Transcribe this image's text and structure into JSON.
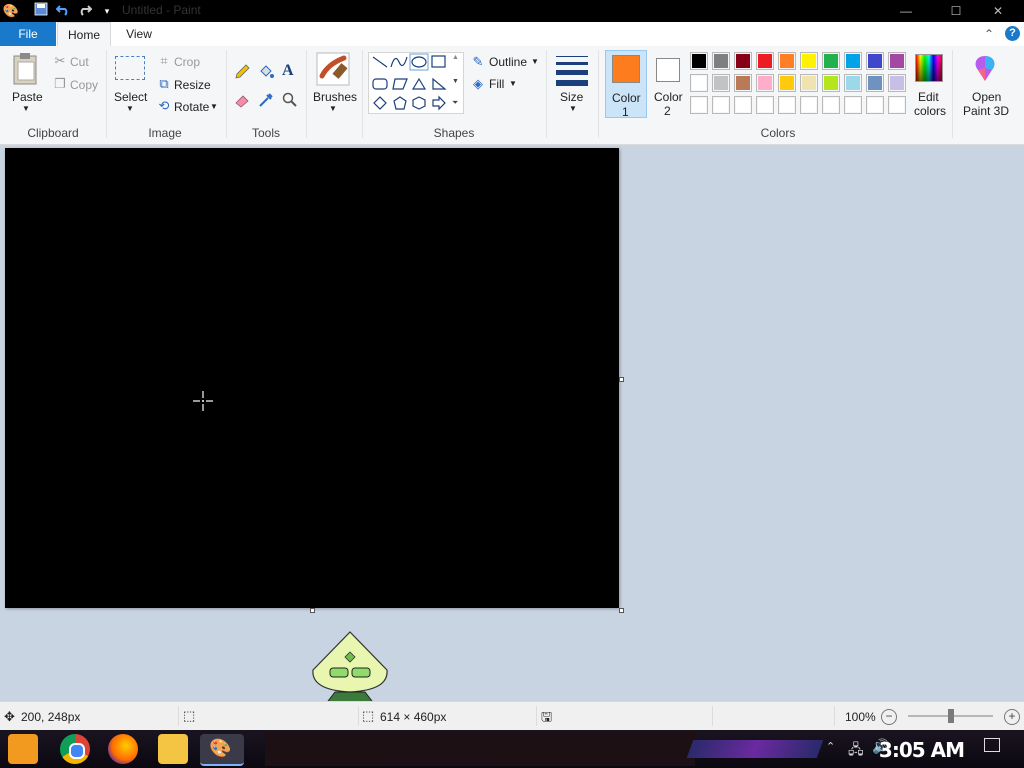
{
  "window": {
    "title": "Untitled - Paint",
    "minimize": "—",
    "maximize": "☐",
    "close": "✕"
  },
  "tabs": {
    "file": "File",
    "home": "Home",
    "view": "View"
  },
  "ribbon": {
    "clipboard": {
      "group": "Clipboard",
      "paste": "Paste",
      "cut": "Cut",
      "copy": "Copy"
    },
    "image": {
      "group": "Image",
      "select": "Select",
      "crop": "Crop",
      "resize": "Resize",
      "rotate": "Rotate"
    },
    "tools": {
      "group": "Tools"
    },
    "brushes": "Brushes",
    "shapes": {
      "group": "Shapes",
      "outline": "Outline",
      "fill": "Fill"
    },
    "size": "Size",
    "colors": {
      "group": "Colors",
      "color1_line1": "Color",
      "color1_line2": "1",
      "color2_line1": "Color",
      "color2_line2": "2",
      "edit_line1": "Edit",
      "edit_line2": "colors",
      "color1": "#fd7d1e",
      "color2": "#ffffff",
      "palette_row1": [
        "#000000",
        "#7f7f7f",
        "#880015",
        "#ed1c24",
        "#ff7f27",
        "#fff200",
        "#22b14c",
        "#00a2e8",
        "#3f48cc",
        "#a349a4"
      ],
      "palette_row2": [
        "#ffffff",
        "#c3c3c3",
        "#b97a57",
        "#ffaec9",
        "#ffc90e",
        "#efe4b0",
        "#b5e61d",
        "#99d9ea",
        "#7092be",
        "#c8bfe7"
      ],
      "palette_row3": [
        "#ffffff",
        "#ffffff",
        "#ffffff",
        "#ffffff",
        "#ffffff",
        "#ffffff",
        "#ffffff",
        "#ffffff",
        "#ffffff",
        "#ffffff"
      ]
    },
    "paint3d_line1": "Open",
    "paint3d_line2": "Paint 3D"
  },
  "status": {
    "cursor_pos": "200, 248px",
    "canvas_size": "614 × 460px",
    "zoom": "100%",
    "zoom_fraction": 0.5
  },
  "taskbar": {
    "clock": "3:05 AM"
  }
}
